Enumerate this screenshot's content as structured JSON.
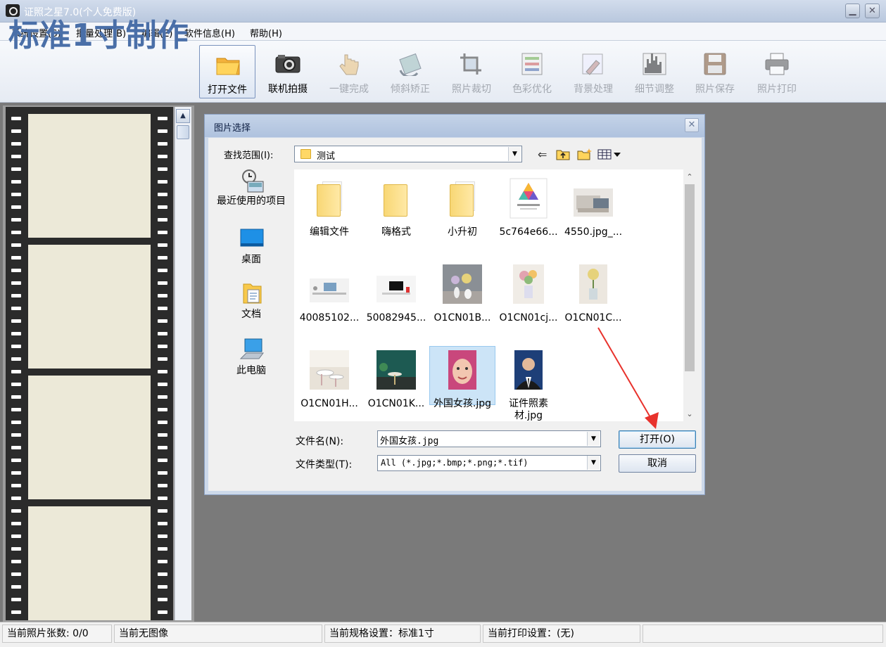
{
  "window": {
    "title": "证照之星7.0(个人免费版)",
    "minimize_glyph": "▁",
    "close_glyph": "✕"
  },
  "menu": [
    "系统设置(S)",
    "批量处理(B)",
    "编辑(E)",
    "软件信息(H)",
    "帮助(H)"
  ],
  "toolbar": {
    "heading": "标准1寸制作",
    "tools": [
      {
        "label": "打开文件",
        "icon": "open-folder-icon",
        "state": "active"
      },
      {
        "label": "联机拍摄",
        "icon": "camera-icon",
        "state": "enabled"
      },
      {
        "label": "一键完成",
        "icon": "hand-click-icon",
        "state": "disabled"
      },
      {
        "label": "倾斜矫正",
        "icon": "rotate-icon",
        "state": "disabled"
      },
      {
        "label": "照片裁切",
        "icon": "crop-icon",
        "state": "disabled"
      },
      {
        "label": "色彩优化",
        "icon": "color-adjust-icon",
        "state": "disabled"
      },
      {
        "label": "背景处理",
        "icon": "brush-icon",
        "state": "disabled"
      },
      {
        "label": "细节调整",
        "icon": "histogram-icon",
        "state": "disabled"
      },
      {
        "label": "照片保存",
        "icon": "floppy-disk-icon",
        "state": "disabled"
      },
      {
        "label": "照片打印",
        "icon": "printer-icon",
        "state": "disabled"
      }
    ]
  },
  "dialog": {
    "title": "图片选择",
    "close_glyph": "✕",
    "look_in_label": "查找范围(I):",
    "look_in_value": "测试",
    "places": [
      {
        "label": "最近使用的项目",
        "icon": "recent-items-icon"
      },
      {
        "label": "桌面",
        "icon": "desktop-icon"
      },
      {
        "label": "文档",
        "icon": "documents-icon"
      },
      {
        "label": "此电脑",
        "icon": "computer-icon"
      }
    ],
    "files": [
      {
        "name": "编辑文件",
        "kind": "folder"
      },
      {
        "name": "嗨格式",
        "kind": "folder"
      },
      {
        "name": "小升初",
        "kind": "folder"
      },
      {
        "name": "5c764e66...",
        "kind": "image"
      },
      {
        "name": "4550.jpg_...",
        "kind": "image"
      },
      {
        "name": "40085102...",
        "kind": "image"
      },
      {
        "name": "50082945...",
        "kind": "image"
      },
      {
        "name": "O1CN01B...",
        "kind": "image"
      },
      {
        "name": "O1CN01cj...",
        "kind": "image"
      },
      {
        "name": "O1CN01C...",
        "kind": "image"
      },
      {
        "name": "O1CN01H...",
        "kind": "image"
      },
      {
        "name": "O1CN01K...",
        "kind": "image"
      },
      {
        "name": "外国女孩.jpg",
        "kind": "image",
        "selected": true
      },
      {
        "name": "证件照素材.jpg",
        "kind": "image"
      }
    ],
    "filename_label": "文件名(N):",
    "filename_value": "外国女孩.jpg",
    "filetype_label": "文件类型(T):",
    "filetype_value": "All (*.jpg;*.bmp;*.png;*.tif)",
    "open_button": "打开(O)",
    "cancel_button": "取消"
  },
  "status": [
    "当前照片张数: 0/0",
    "当前无图像",
    "当前规格设置：标准1寸",
    "当前打印设置：(无)",
    ""
  ],
  "colors": {
    "accent_title": "#4a6fa8",
    "annotation_arrow": "#e8322c",
    "selection": "#cce4f7"
  }
}
